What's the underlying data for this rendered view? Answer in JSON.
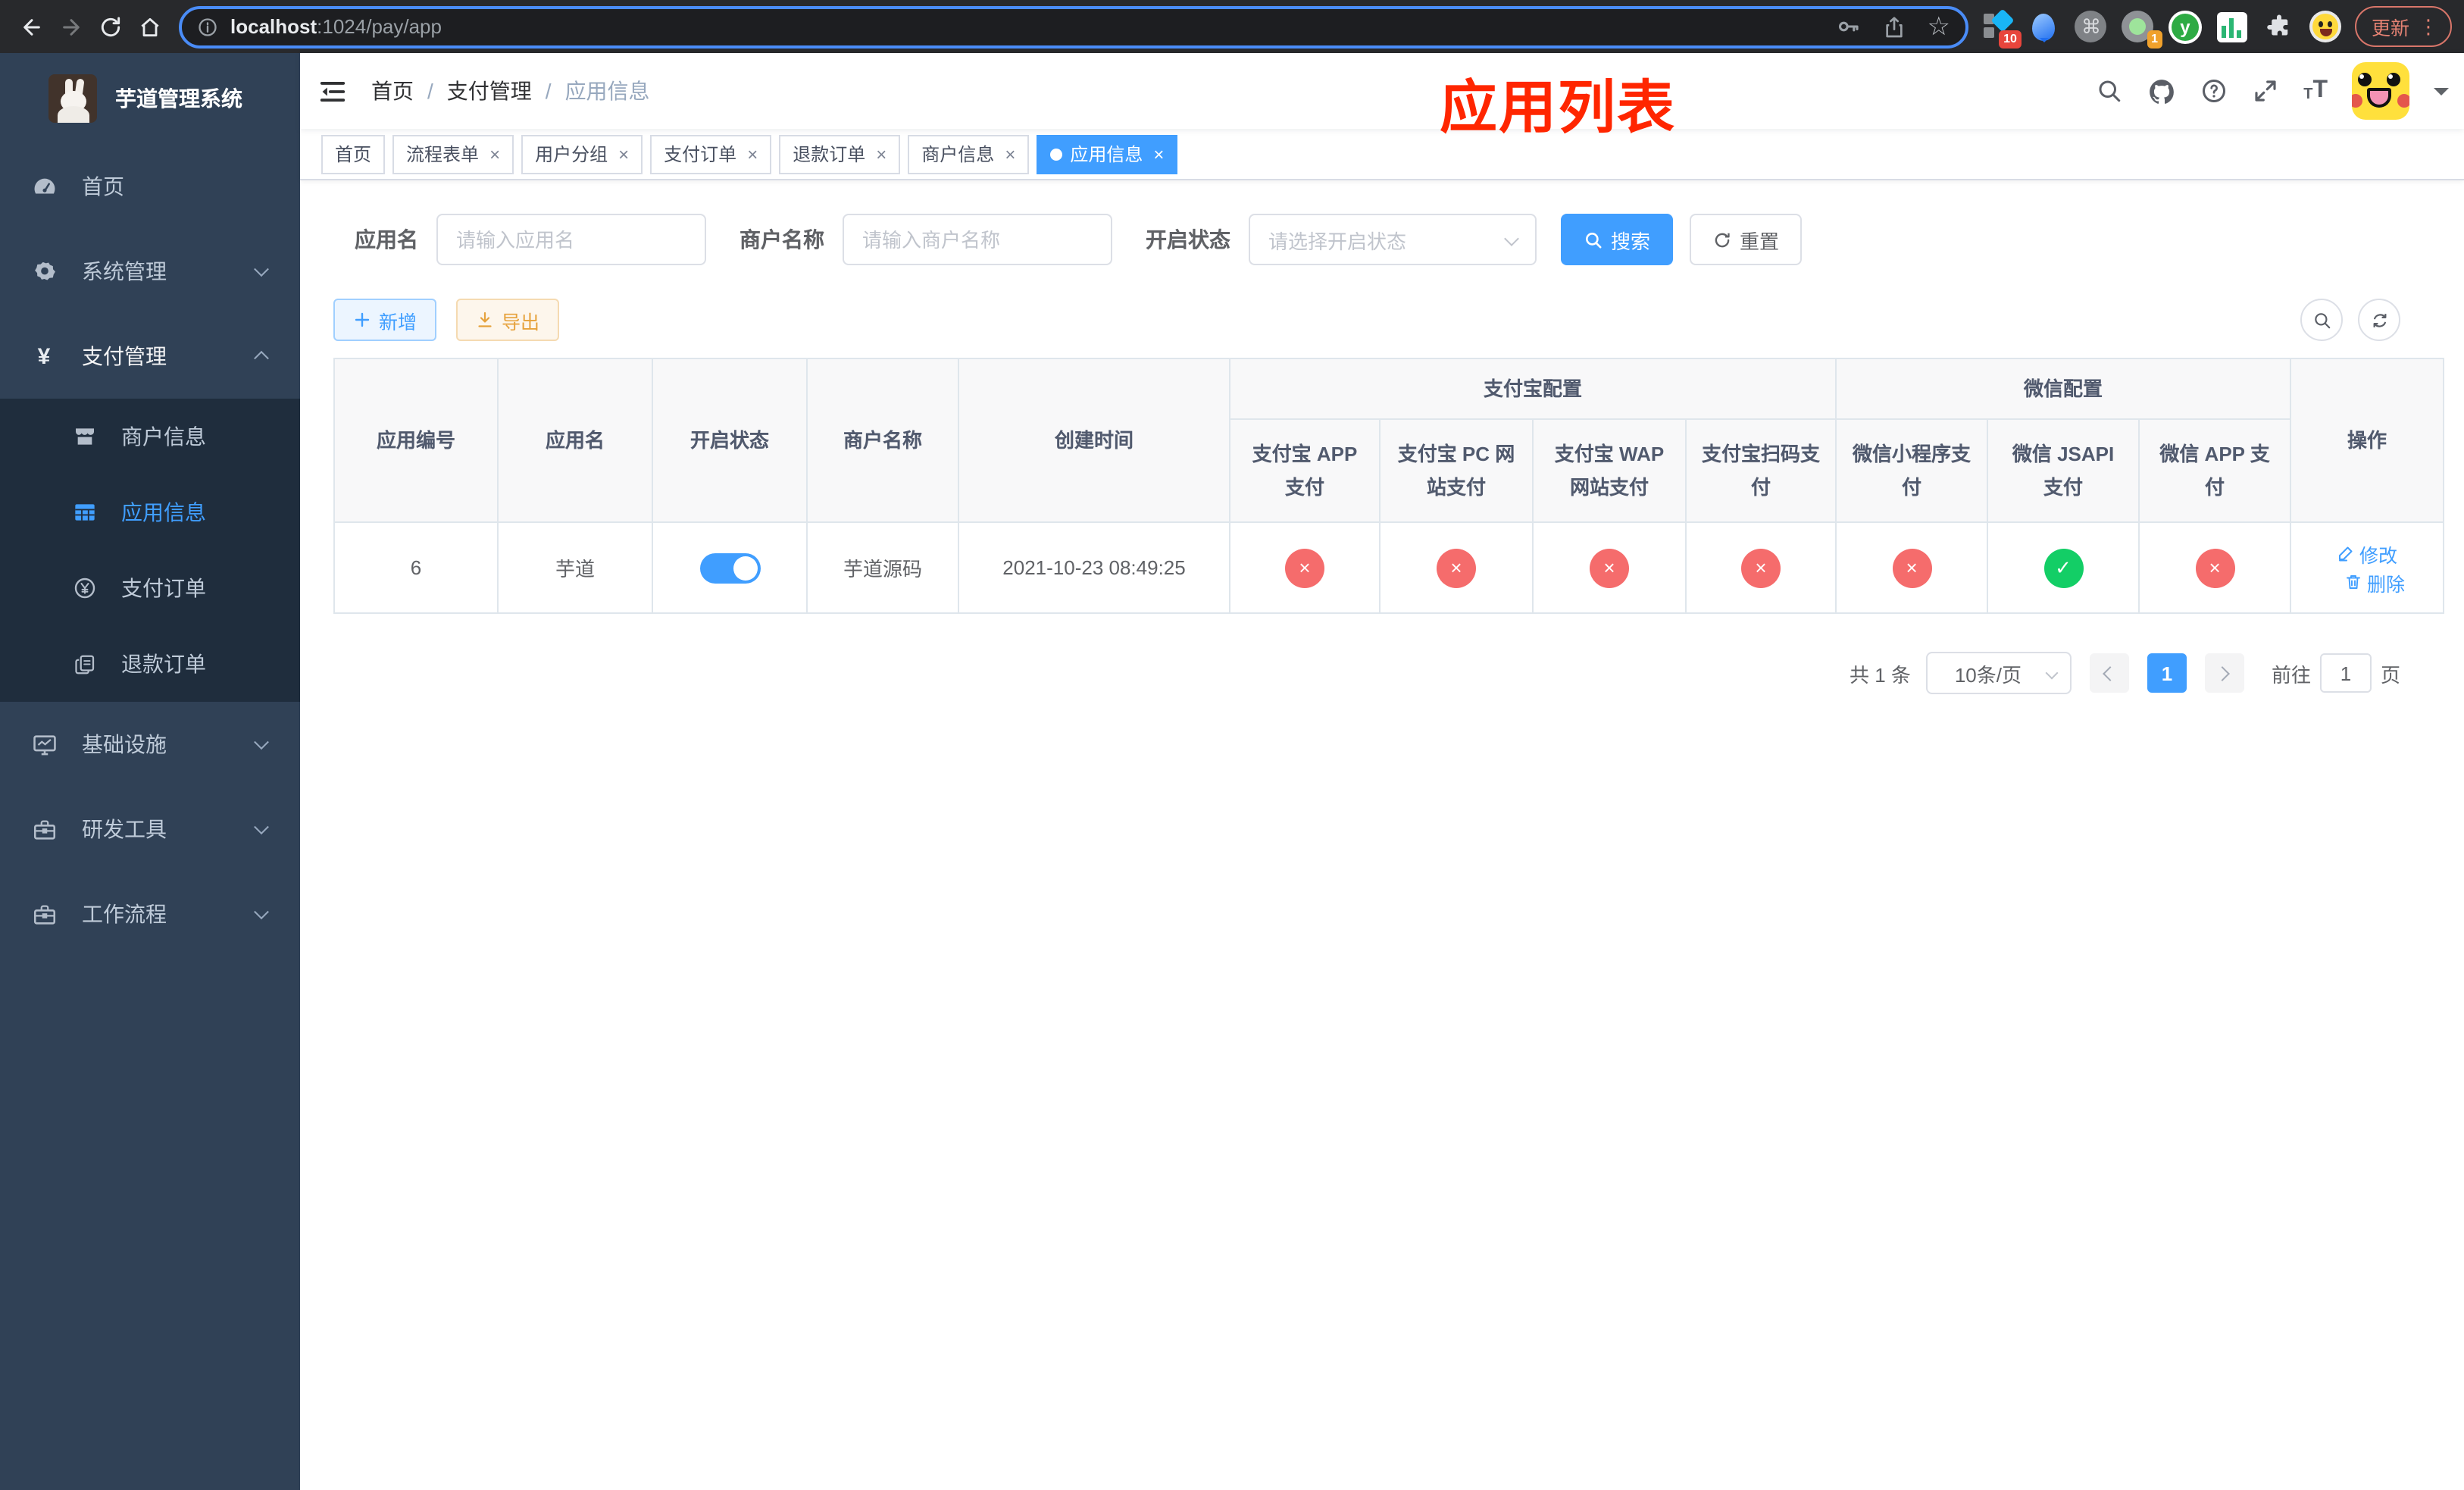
{
  "browser": {
    "url": {
      "host": "localhost",
      "path": ":1024/pay/app"
    },
    "update_button": "更新",
    "extension_badges": {
      "pixel": "10",
      "recorder": "1"
    },
    "ext_y_letter": "y"
  },
  "sidebar": {
    "title": "芋道管理系统",
    "menu_home": "首页",
    "menu_system": "系统管理",
    "menu_payment": "支付管理",
    "payment_submenu": [
      {
        "label": "商户信息"
      },
      {
        "label": "应用信息"
      },
      {
        "label": "支付订单"
      },
      {
        "label": "退款订单"
      }
    ],
    "menu_infra": "基础设施",
    "menu_devtool": "研发工具",
    "menu_workflow": "工作流程"
  },
  "header": {
    "breadcrumb": [
      {
        "label": "首页"
      },
      {
        "label": "支付管理"
      },
      {
        "label": "应用信息"
      }
    ],
    "separator": "/",
    "annotation": "应用列表"
  },
  "tabs": [
    {
      "label": "首页",
      "closable": false,
      "active": false
    },
    {
      "label": "流程表单",
      "closable": true,
      "active": false
    },
    {
      "label": "用户分组",
      "closable": true,
      "active": false
    },
    {
      "label": "支付订单",
      "closable": true,
      "active": false
    },
    {
      "label": "退款订单",
      "closable": true,
      "active": false
    },
    {
      "label": "商户信息",
      "closable": true,
      "active": false
    },
    {
      "label": "应用信息",
      "closable": true,
      "active": true
    }
  ],
  "filters": {
    "app_name_label": "应用名",
    "app_name_placeholder": "请输入应用名",
    "merchant_label": "商户名称",
    "merchant_placeholder": "请输入商户名称",
    "status_label": "开启状态",
    "status_placeholder": "请选择开启状态",
    "search_button": "搜索",
    "reset_button": "重置"
  },
  "toolbar": {
    "add_button": "新增",
    "export_button": "导出"
  },
  "table": {
    "columns": {
      "app_id": "应用编号",
      "app_name": "应用名",
      "status": "开启状态",
      "merchant": "商户名称",
      "created": "创建时间",
      "action": "操作"
    },
    "alipay_group": {
      "label": "支付宝配置",
      "cols": [
        "支付宝 APP 支付",
        "支付宝 PC 网站支付",
        "支付宝 WAP 网站支付",
        "支付宝扫码支付"
      ]
    },
    "wechat_group": {
      "label": "微信配置",
      "cols": [
        "微信小程序支付",
        "微信 JSAPI 支付",
        "微信 APP 支付"
      ]
    },
    "row": {
      "id": "6",
      "name": "芋道",
      "enabled": true,
      "merchant": "芋道源码",
      "created": "2021-10-23 08:49:25",
      "statuses": [
        false,
        false,
        false,
        false,
        false,
        true,
        false
      ],
      "edit_label": "修改",
      "delete_label": "删除"
    }
  },
  "pagination": {
    "total": "共 1 条",
    "page_size": "10条/页",
    "page": "1",
    "goto_label": "前往",
    "goto_value": "1",
    "page_suffix": "页"
  },
  "icons": {
    "close": "×",
    "check": "✓",
    "cross": "×",
    "dots": "⋮",
    "star": "☆",
    "cmd": "⌘",
    "yen": "¥",
    "plus": "＋"
  },
  "colors": {
    "accent": "#409eff",
    "danger": "#f56c6c",
    "success": "#13ce66",
    "warning": "#e6a23c",
    "annotation": "#ff2600",
    "sidebar_bg": "#304156",
    "submenu_bg": "#1f2d3d"
  }
}
